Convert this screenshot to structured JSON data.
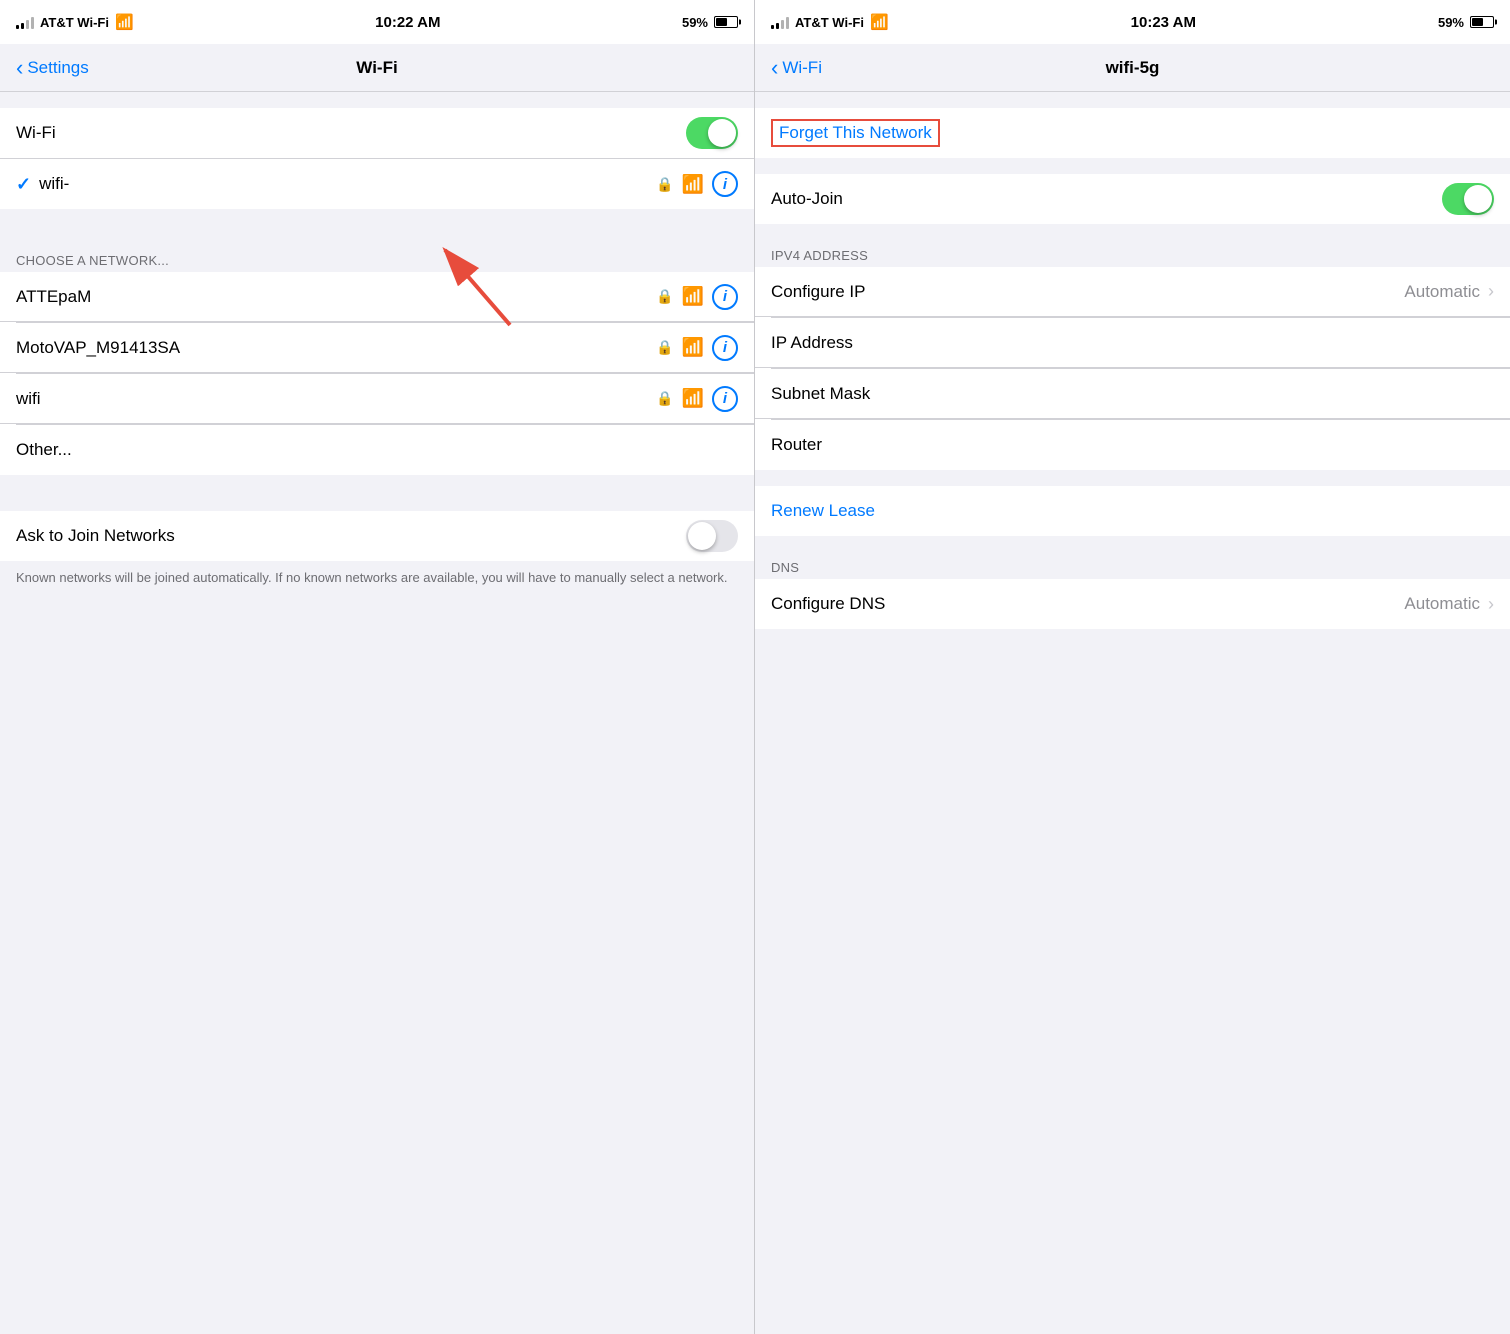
{
  "left_panel": {
    "status_bar": {
      "carrier": "AT&T Wi-Fi",
      "time": "10:22 AM",
      "battery_pct": "59%"
    },
    "nav": {
      "back_label": "Settings",
      "title": "Wi-Fi"
    },
    "wifi_row": {
      "label": "Wi-Fi",
      "toggle_state": "on"
    },
    "connected_network": {
      "name": "wifi-",
      "checkmark": "✓"
    },
    "section_header": "CHOOSE A NETWORK...",
    "networks": [
      {
        "name": "ATTEpaM"
      },
      {
        "name": "MotoVAP_M91413SA"
      },
      {
        "name": "wifi"
      },
      {
        "name": "Other..."
      }
    ],
    "ask_join": {
      "label": "Ask to Join Networks",
      "toggle_state": "off"
    },
    "footer": "Known networks will be joined automatically. If no known networks are available, you will have to manually select a network."
  },
  "right_panel": {
    "status_bar": {
      "carrier": "AT&T Wi-Fi",
      "time": "10:23 AM",
      "battery_pct": "59%"
    },
    "nav": {
      "back_label": "Wi-Fi",
      "title": "wifi-5g"
    },
    "forget_network": "Forget This Network",
    "auto_join": {
      "label": "Auto-Join",
      "toggle_state": "on"
    },
    "ipv4_header": "IPV4 ADDRESS",
    "configure_ip": {
      "label": "Configure IP",
      "value": "Automatic"
    },
    "ip_address": {
      "label": "IP Address"
    },
    "subnet_mask": {
      "label": "Subnet Mask"
    },
    "router": {
      "label": "Router"
    },
    "renew_lease": "Renew Lease",
    "dns_header": "DNS",
    "configure_dns": {
      "label": "Configure DNS",
      "value": "Automatic"
    }
  },
  "icons": {
    "lock": "🔒",
    "wifi": "📶",
    "info": "i",
    "chevron_left": "‹",
    "chevron_right": "›",
    "check": "✓"
  }
}
